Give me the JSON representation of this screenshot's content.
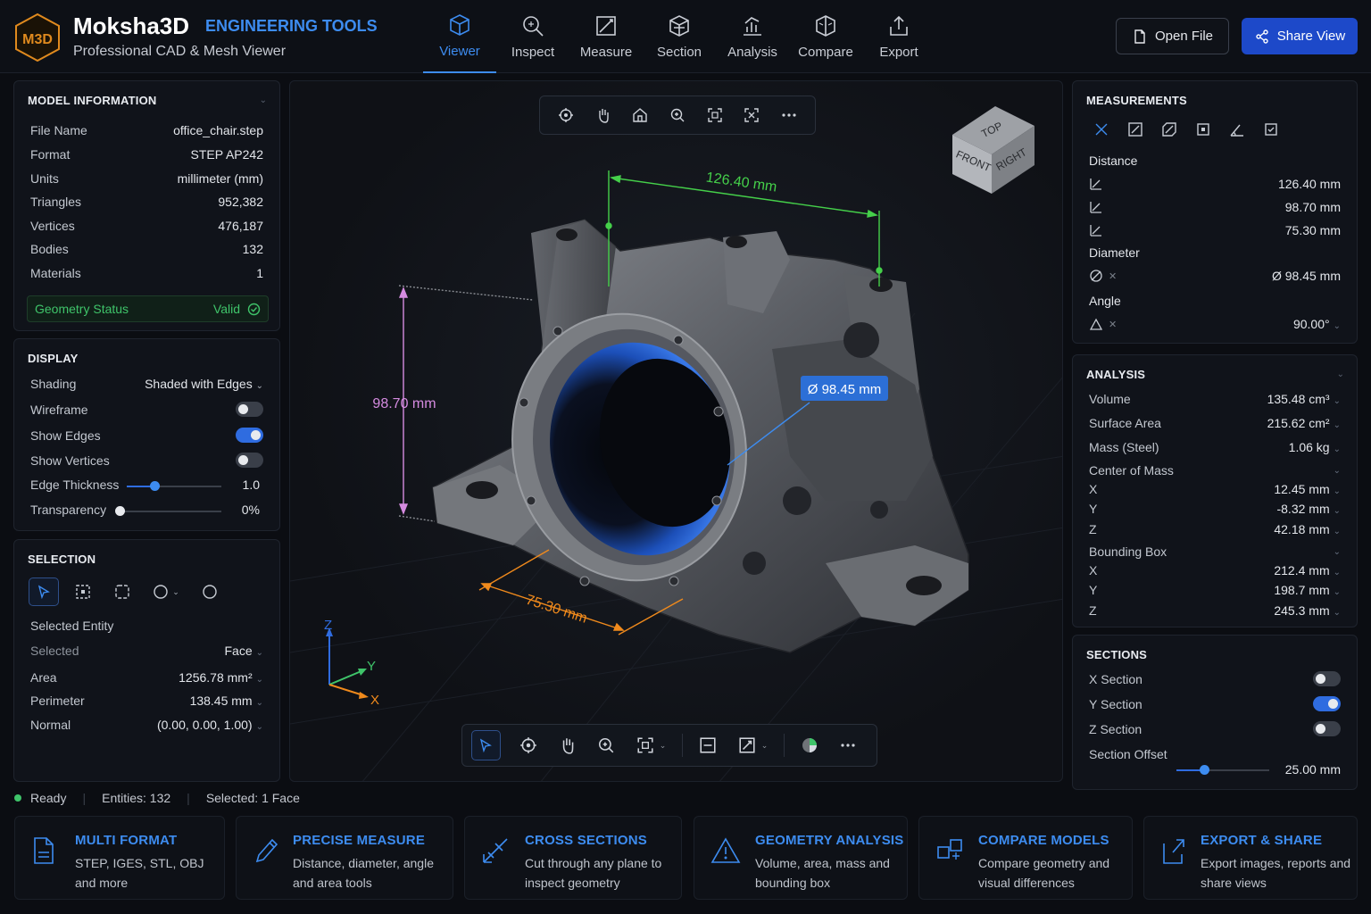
{
  "app": {
    "logo_text": "M3D",
    "name": "Moksha3D",
    "tagline": "ENGINEERING TOOLS",
    "subtitle": "Professional CAD & Mesh Viewer"
  },
  "nav": {
    "tabs": [
      {
        "label": "Viewer",
        "icon": "cube-icon",
        "active": true
      },
      {
        "label": "Inspect",
        "icon": "magnifier-icon"
      },
      {
        "label": "Measure",
        "icon": "ruler-icon"
      },
      {
        "label": "Section",
        "icon": "section-cube-icon"
      },
      {
        "label": "Analysis",
        "icon": "chart-icon"
      },
      {
        "label": "Compare",
        "icon": "compare-icon"
      },
      {
        "label": "Export",
        "icon": "export-icon"
      }
    ],
    "open_file": "Open File",
    "share_view": "Share View"
  },
  "model_info": {
    "title": "MODEL INFORMATION",
    "rows": [
      {
        "key": "File Name",
        "value": "office_chair.step"
      },
      {
        "key": "Format",
        "value": "STEP AP242"
      },
      {
        "key": "Units",
        "value": "millimeter (mm)"
      },
      {
        "key": "Triangles",
        "value": "952,382"
      },
      {
        "key": "Vertices",
        "value": "476,187"
      },
      {
        "key": "Bodies",
        "value": "132"
      },
      {
        "key": "Materials",
        "value": "1"
      }
    ],
    "geometry_status_label": "Geometry Status",
    "geometry_status_value": "Valid"
  },
  "display": {
    "title": "DISPLAY",
    "shading_label": "Shading",
    "shading_value": "Shaded with Edges",
    "wireframe_label": "Wireframe",
    "wireframe_on": false,
    "show_edges_label": "Show Edges",
    "show_edges_on": true,
    "show_vertices_label": "Show Vertices",
    "show_vertices_on": false,
    "edge_thickness_label": "Edge Thickness",
    "edge_thickness_value": "1.0",
    "edge_thickness_fraction": 0.29,
    "transparency_label": "Transparency",
    "transparency_value": "0%",
    "transparency_fraction": 0.0
  },
  "selection": {
    "title": "SELECTION",
    "selected_entity_label": "Selected Entity",
    "selected_label": "Selected",
    "selected_value": "Face",
    "area_label": "Area",
    "area_value": "1256.78 mm²",
    "perimeter_label": "Perimeter",
    "perimeter_value": "138.45 mm",
    "normal_label": "Normal",
    "normal_value": "(0.00, 0.00, 1.00)"
  },
  "viewport": {
    "dim_top": "126.40 mm",
    "dim_left": "98.70 mm",
    "dim_bottom": "75.30 mm",
    "dim_diameter": "Ø 98.45 mm",
    "cube_top": "TOP",
    "cube_front": "FRONT",
    "cube_right": "RIGHT",
    "axis_x": "X",
    "axis_y": "Y",
    "axis_z": "Z"
  },
  "measurements": {
    "title": "MEASUREMENTS",
    "distance_label": "Distance",
    "distances": [
      "126.40 mm",
      "98.70 mm",
      "75.30 mm"
    ],
    "diameter_label": "Diameter",
    "diameter_value": "Ø 98.45 mm",
    "angle_label": "Angle",
    "angle_value": "90.00°"
  },
  "analysis": {
    "title": "ANALYSIS",
    "volume_label": "Volume",
    "volume_value": "135.48 cm³",
    "surface_label": "Surface Area",
    "surface_value": "215.62 cm²",
    "mass_label": "Mass (Steel)",
    "mass_value": "1.06 kg",
    "com_label": "Center of Mass",
    "com": [
      {
        "axis": "X",
        "value": "12.45 mm"
      },
      {
        "axis": "Y",
        "value": "-8.32 mm"
      },
      {
        "axis": "Z",
        "value": "42.18 mm"
      }
    ],
    "bbox_label": "Bounding Box",
    "bbox": [
      {
        "axis": "X",
        "value": "212.4 mm"
      },
      {
        "axis": "Y",
        "value": "198.7 mm"
      },
      {
        "axis": "Z",
        "value": "245.3 mm"
      }
    ]
  },
  "sections": {
    "title": "SECTIONS",
    "x_label": "X Section",
    "x_on": false,
    "y_label": "Y Section",
    "y_on": true,
    "z_label": "Z Section",
    "z_on": false,
    "offset_label": "Section Offset",
    "offset_value": "25.00 mm",
    "offset_fraction": 0.3
  },
  "status": {
    "ready": "Ready",
    "entities": "Entities: 132",
    "selected": "Selected: 1 Face"
  },
  "features": [
    {
      "title": "MULTI FORMAT",
      "desc": "STEP, IGES, STL, OBJ and more"
    },
    {
      "title": "PRECISE MEASURE",
      "desc": "Distance, diameter, angle and area tools"
    },
    {
      "title": "CROSS SECTIONS",
      "desc": "Cut through any plane to inspect geometry"
    },
    {
      "title": "GEOMETRY ANALYSIS",
      "desc": "Volume, area, mass and bounding box"
    },
    {
      "title": "COMPARE MODELS",
      "desc": "Compare geometry and visual differences"
    },
    {
      "title": "EXPORT & SHARE",
      "desc": "Export images, reports and share views"
    }
  ],
  "colors": {
    "accent": "#3d8cf0",
    "button_primary": "#1d49c9",
    "status_ok": "#3fc46a",
    "dim_green": "#45d04a",
    "dim_pink": "#d58be0",
    "dim_orange": "#f08a1c"
  }
}
